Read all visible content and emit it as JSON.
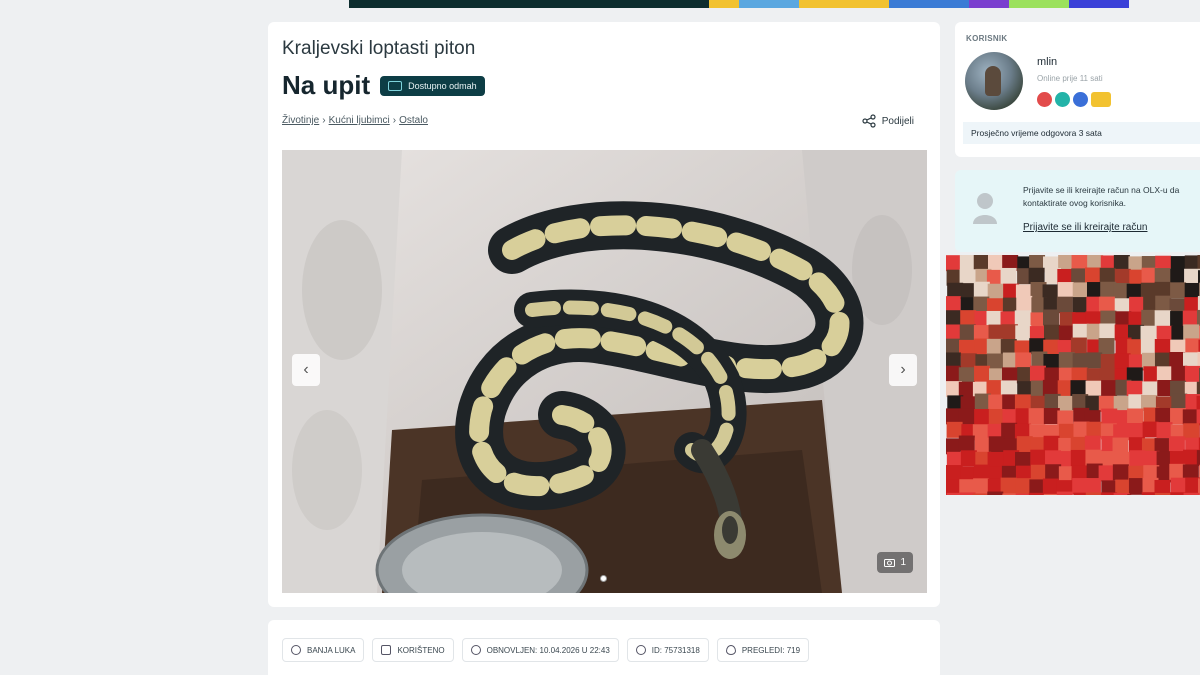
{
  "top_strip_colors": [
    "#0d2d2f",
    "#0d2d2f",
    "#0d2d2f",
    "#f2c230",
    "#5aa7e0",
    "#f2c230",
    "#3a7bd5",
    "#7a3fcf",
    "#9be15d",
    "#3a40d8"
  ],
  "listing": {
    "title": "Kraljevski loptasti piton",
    "price": "Na upit",
    "availability_badge": "Dostupno odmah",
    "breadcrumb": [
      "Životinje",
      "Kućni ljubimci",
      "Ostalo"
    ],
    "share_label": "Podijeli",
    "gallery": {
      "prev_icon": "chevron-left-icon",
      "next_icon": "chevron-right-icon",
      "photo_count": "1"
    }
  },
  "meta_chips": [
    {
      "icon": "location-pin-icon",
      "label": "BANJA LUKA"
    },
    {
      "icon": "tag-icon",
      "label": "KORIŠTENO"
    },
    {
      "icon": "clock-icon",
      "label": "OBNOVLJEN: 10.04.2026 U 22:43"
    },
    {
      "icon": "id-icon",
      "label": "ID: 75731318"
    },
    {
      "icon": "eye-icon",
      "label": "PREGLEDI: 719"
    }
  ],
  "user": {
    "section_label": "KORISNIK",
    "name": "mlin",
    "online": "Online prije 11 sati",
    "response_time": "Prosječno vrijeme odgovora 3 sata"
  },
  "login_prompt": {
    "text_line1": "Prijavite se ili kreirajte račun na OLX-u da",
    "text_line2": "kontaktirate ovog korisnika.",
    "link": "Prijavite se ili kreirajte račun"
  },
  "colors": {
    "badge_bg": "#0d3d45",
    "accent_teal": "#7fd3dc",
    "login_card_bg": "#e6f6f8"
  }
}
